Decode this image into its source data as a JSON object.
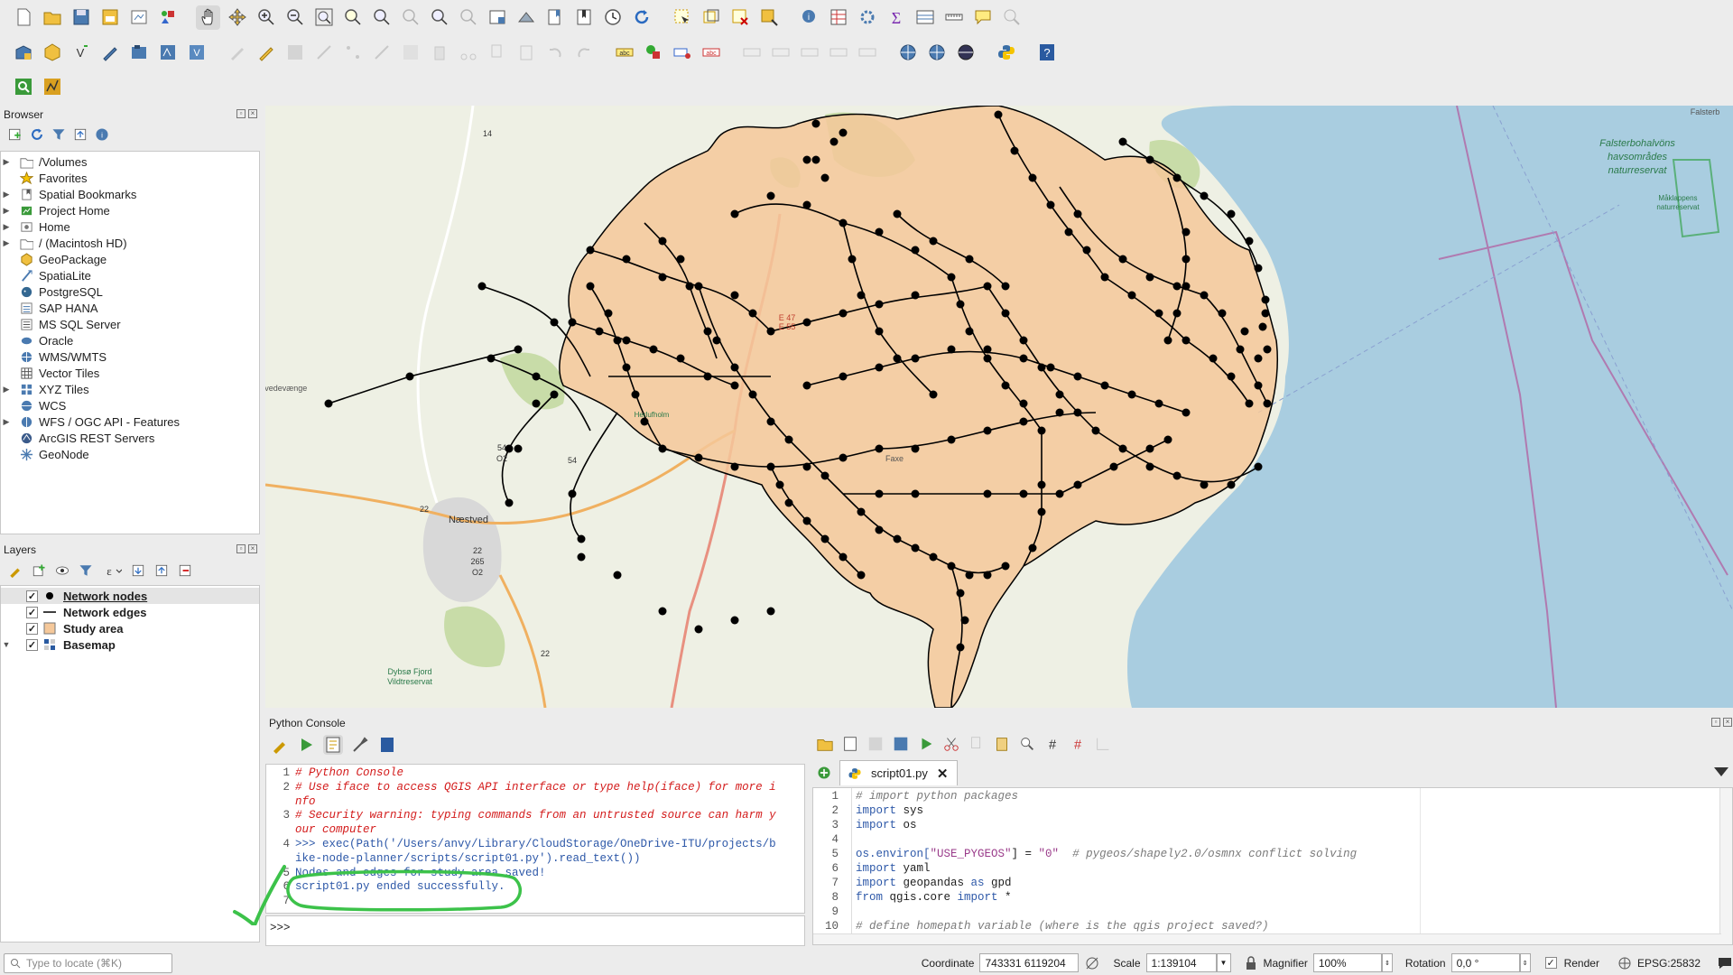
{
  "toolbar": {
    "row1": [
      "new-project",
      "open-project",
      "save-project",
      "save-as",
      "print-layout",
      "style-manager",
      "pan",
      "pan-to-selection",
      "zoom-in",
      "zoom-out",
      "zoom-full",
      "zoom-to-selection",
      "zoom-to-layer",
      "zoom-native",
      "zoom-last",
      "zoom-next",
      "new-map-view",
      "new-3d-view",
      "new-spatial-bookmark",
      "show-bookmarks",
      "temporal-controller",
      "refresh",
      "select-features",
      "select-by-value",
      "deselect",
      "select-location",
      "identify",
      "attribute-table",
      "toolbox",
      "statistics",
      "field-calculator",
      "measure",
      "map-tips",
      "locate"
    ],
    "row2": [
      "data-source-manager",
      "new-geopackage",
      "new-shapefile",
      "new-scratch",
      "new-virtual",
      "digitize",
      "current-edits",
      "toggle-editing",
      "save-edits",
      "add-point",
      "vertex-tool",
      "digitize-shape",
      "modify-attr",
      "delete",
      "cut",
      "copy",
      "paste",
      "undo",
      "redo",
      "label-tool",
      "pin-labels",
      "highlight-labels",
      "show-hide-labels",
      "move-label",
      "rotate-label",
      "change-label",
      "plugin1",
      "plugin2",
      "plugin3",
      "python-console",
      "help"
    ],
    "row3": [
      "processing-1",
      "processing-2"
    ]
  },
  "browser": {
    "title": "Browser",
    "items": [
      {
        "label": "/Volumes",
        "arrow": true,
        "icon": "folder-icon"
      },
      {
        "label": "Favorites",
        "arrow": false,
        "icon": "star-icon"
      },
      {
        "label": "Spatial Bookmarks",
        "arrow": true,
        "icon": "bookmark-icon"
      },
      {
        "label": "Project Home",
        "arrow": true,
        "icon": "project-home-icon"
      },
      {
        "label": "Home",
        "arrow": true,
        "icon": "home-folder-icon"
      },
      {
        "label": "/ (Macintosh HD)",
        "arrow": true,
        "icon": "folder-icon"
      },
      {
        "label": "GeoPackage",
        "arrow": false,
        "icon": "geopackage-icon"
      },
      {
        "label": "SpatiaLite",
        "arrow": false,
        "icon": "spatialite-icon"
      },
      {
        "label": "PostgreSQL",
        "arrow": false,
        "icon": "postgresql-icon"
      },
      {
        "label": "SAP HANA",
        "arrow": false,
        "icon": "hana-icon"
      },
      {
        "label": "MS SQL Server",
        "arrow": false,
        "icon": "mssql-icon"
      },
      {
        "label": "Oracle",
        "arrow": false,
        "icon": "oracle-icon"
      },
      {
        "label": "WMS/WMTS",
        "arrow": false,
        "icon": "wms-icon"
      },
      {
        "label": "Vector Tiles",
        "arrow": false,
        "icon": "vector-tiles-icon"
      },
      {
        "label": "XYZ Tiles",
        "arrow": true,
        "icon": "xyz-tiles-icon"
      },
      {
        "label": "WCS",
        "arrow": false,
        "icon": "wcs-icon"
      },
      {
        "label": "WFS / OGC API - Features",
        "arrow": true,
        "icon": "wfs-icon"
      },
      {
        "label": "ArcGIS REST Servers",
        "arrow": false,
        "icon": "arcgis-icon"
      },
      {
        "label": "GeoNode",
        "arrow": false,
        "icon": "geonode-icon"
      }
    ]
  },
  "layers": {
    "title": "Layers",
    "items": [
      {
        "label": "Network nodes",
        "symbol": "point"
      },
      {
        "label": "Network edges",
        "symbol": "line"
      },
      {
        "label": "Study area",
        "symbol": "polygon"
      },
      {
        "label": "Basemap",
        "symbol": "raster"
      }
    ]
  },
  "map": {
    "labels": {
      "naestved": "Næstved",
      "tvedevaenge": "Tvedevænge",
      "faxe": "Faxe",
      "falsterbohalvons": "Falsterbohalvöns",
      "havsomrades": "havsområdes",
      "naturreservat": "naturreservat",
      "maklappens": "Måklappens",
      "naturreservat2": "naturreservat",
      "falsterbo": "Falsterb",
      "road14": "14",
      "road54": "54",
      "road54b": "O2",
      "road54c": "54",
      "road22": "22",
      "road22b": "265",
      "road22c": "O2",
      "road22d": "22",
      "road265": "22",
      "e47": "E 47",
      "e55": "E 55",
      "dybso": "Dybsø Fjord",
      "dybso2": "Vildtreservat",
      "herlufsholm": "Herlufholm"
    },
    "colors": {
      "study_area": "#f5c89a",
      "sea": "#a9cde0",
      "land": "#eef0e4",
      "forest": "#c8dca8",
      "edge": "#000000"
    }
  },
  "console": {
    "title": "Python Console",
    "lines": [
      {
        "n": "1",
        "text": "# Python Console",
        "cls": "cm"
      },
      {
        "n": "2",
        "text": "# Use iface to access QGIS API interface or type help(iface) for more i",
        "cls": "cm"
      },
      {
        "n": "",
        "text": "nfo",
        "cls": "cm"
      },
      {
        "n": "3",
        "text": "# Security warning: typing commands from an untrusted source can harm y",
        "cls": "cm"
      },
      {
        "n": "",
        "text": "our computer",
        "cls": "cm"
      },
      {
        "n": "4",
        "text": ">>> exec(Path('/Users/anvy/Library/CloudStorage/OneDrive-ITU/projects/b",
        "cls": "bl"
      },
      {
        "n": "",
        "text": "ike-node-planner/scripts/script01.py').read_text())",
        "cls": "bl"
      },
      {
        "n": "5",
        "text": "Nodes and edges for study area saved!",
        "cls": "bl"
      },
      {
        "n": "6",
        "text": "script01.py ended successfully.",
        "cls": "bl"
      },
      {
        "n": "7",
        "text": "",
        "cls": ""
      }
    ],
    "prompt": ">>>"
  },
  "editor": {
    "tab": "script01.py",
    "lines": [
      {
        "n": "1",
        "html_parts": [
          {
            "t": "# import python packages",
            "c": "ecm"
          }
        ]
      },
      {
        "n": "2",
        "html_parts": [
          {
            "t": "import",
            "c": "kw"
          },
          {
            "t": " sys",
            "c": ""
          }
        ]
      },
      {
        "n": "3",
        "html_parts": [
          {
            "t": "import",
            "c": "kw"
          },
          {
            "t": " os",
            "c": ""
          }
        ]
      },
      {
        "n": "4",
        "html_parts": []
      },
      {
        "n": "5",
        "html_parts": [
          {
            "t": "os.environ[",
            "c": "kw"
          },
          {
            "t": "\"USE_PYGEOS\"",
            "c": "str"
          },
          {
            "t": "] = ",
            "c": ""
          },
          {
            "t": "\"0\"",
            "c": "str"
          },
          {
            "t": "  # pygeos/shapely2.0/osmnx conflict solving",
            "c": "ecm"
          }
        ]
      },
      {
        "n": "6",
        "html_parts": [
          {
            "t": "import",
            "c": "kw"
          },
          {
            "t": " yaml",
            "c": ""
          }
        ]
      },
      {
        "n": "7",
        "html_parts": [
          {
            "t": "import",
            "c": "kw"
          },
          {
            "t": " geopandas ",
            "c": ""
          },
          {
            "t": "as",
            "c": "kw"
          },
          {
            "t": " gpd",
            "c": ""
          }
        ]
      },
      {
        "n": "8",
        "html_parts": [
          {
            "t": "from",
            "c": "kw"
          },
          {
            "t": " qgis.core ",
            "c": ""
          },
          {
            "t": "import",
            "c": "kw"
          },
          {
            "t": " *",
            "c": ""
          }
        ]
      },
      {
        "n": "9",
        "html_parts": []
      },
      {
        "n": "10",
        "html_parts": [
          {
            "t": "# define homepath variable (where is the qgis project saved?)",
            "c": "ecm"
          }
        ]
      }
    ]
  },
  "statusbar": {
    "locate_placeholder": "Type to locate (⌘K)",
    "coordinate_label": "Coordinate",
    "coordinate": "743331 6119204",
    "scale_label": "Scale",
    "scale": "1:139104",
    "magnifier_label": "Magnifier",
    "magnifier": "100%",
    "rotation_label": "Rotation",
    "rotation": "0,0 °",
    "render_label": "Render",
    "crs": "EPSG:25832"
  }
}
